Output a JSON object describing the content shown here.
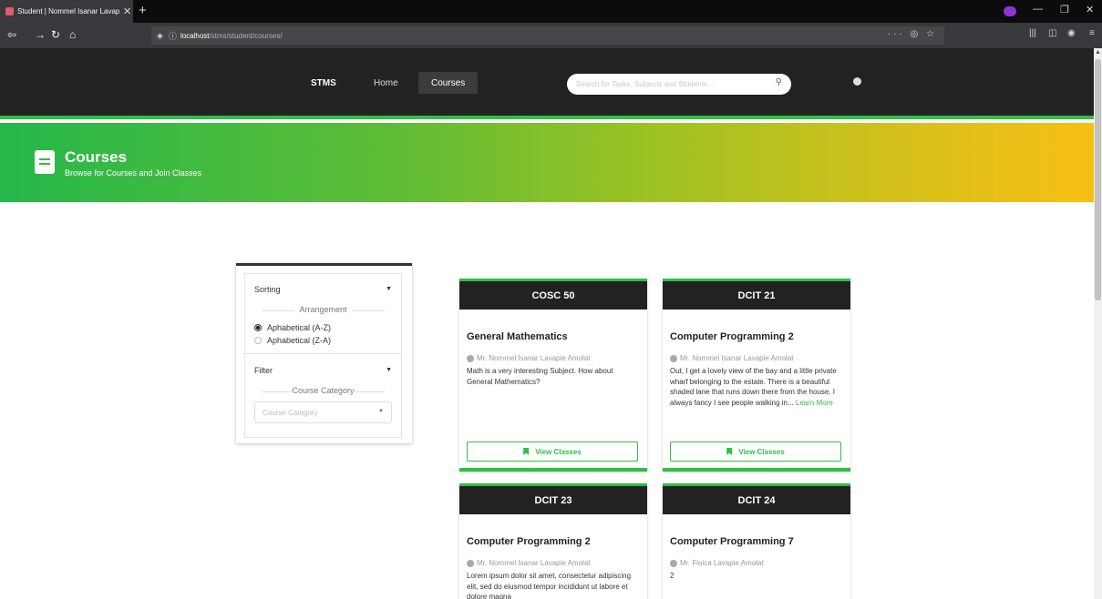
{
  "browser": {
    "tab_title": "Student | Nommel Isanar Lavapie",
    "url_host": "localhost",
    "url_path": "/stms/student/courses/"
  },
  "nav": {
    "brand": "STMS",
    "links": [
      "Home",
      "Courses"
    ],
    "active": "Courses",
    "search_placeholder": "Search for Tasks, Subjects and Students..."
  },
  "hero": {
    "title": "Courses",
    "subtitle": "Browse for Courses and Join Classes"
  },
  "filter_panel": {
    "sorting_label": "Sorting",
    "arrangement_label": "Arrangement",
    "options": [
      {
        "label": "Aphabetical (A-Z)",
        "selected": true
      },
      {
        "label": "Aphabetical (Z-A)",
        "selected": false
      }
    ],
    "filter_label": "Filter",
    "category_label": "Course Category",
    "category_placeholder": "Course Category"
  },
  "courses": [
    {
      "code": "COSC 50",
      "name": "General Mathematics",
      "teacher": "Mr. Nommel Isanar Lavapie Amolat",
      "description": "Math is a very interesting Subject. How about General Mathematics?",
      "more": "",
      "button": "View Classes"
    },
    {
      "code": "DCIT 21",
      "name": "Computer Programming 2",
      "teacher": "Mr. Nommel Isanar Lavapie Amolat",
      "description": "Out, I get a lovely view of the bay and a little private wharf belonging to the estate. There is a beautiful shaded lane that runs down there from the house. I always fancy I see people walking in...",
      "more": "Learn More",
      "button": "View Classes"
    },
    {
      "code": "DCIT 23",
      "name": "Computer Programming 2",
      "teacher": "Mr. Nommel Isanar Lavapie Amolat",
      "description": "Lorem ipsum dolor sit amet, consectetur adipiscing elit, sed do eiusmod tempor incididunt ut labore et dolore magna",
      "more": "",
      "button": ""
    },
    {
      "code": "DCIT 24",
      "name": "Computer Programming 7",
      "teacher": "Mr. Floica Lavapie Amolat",
      "description": "2",
      "more": "",
      "button": ""
    }
  ]
}
